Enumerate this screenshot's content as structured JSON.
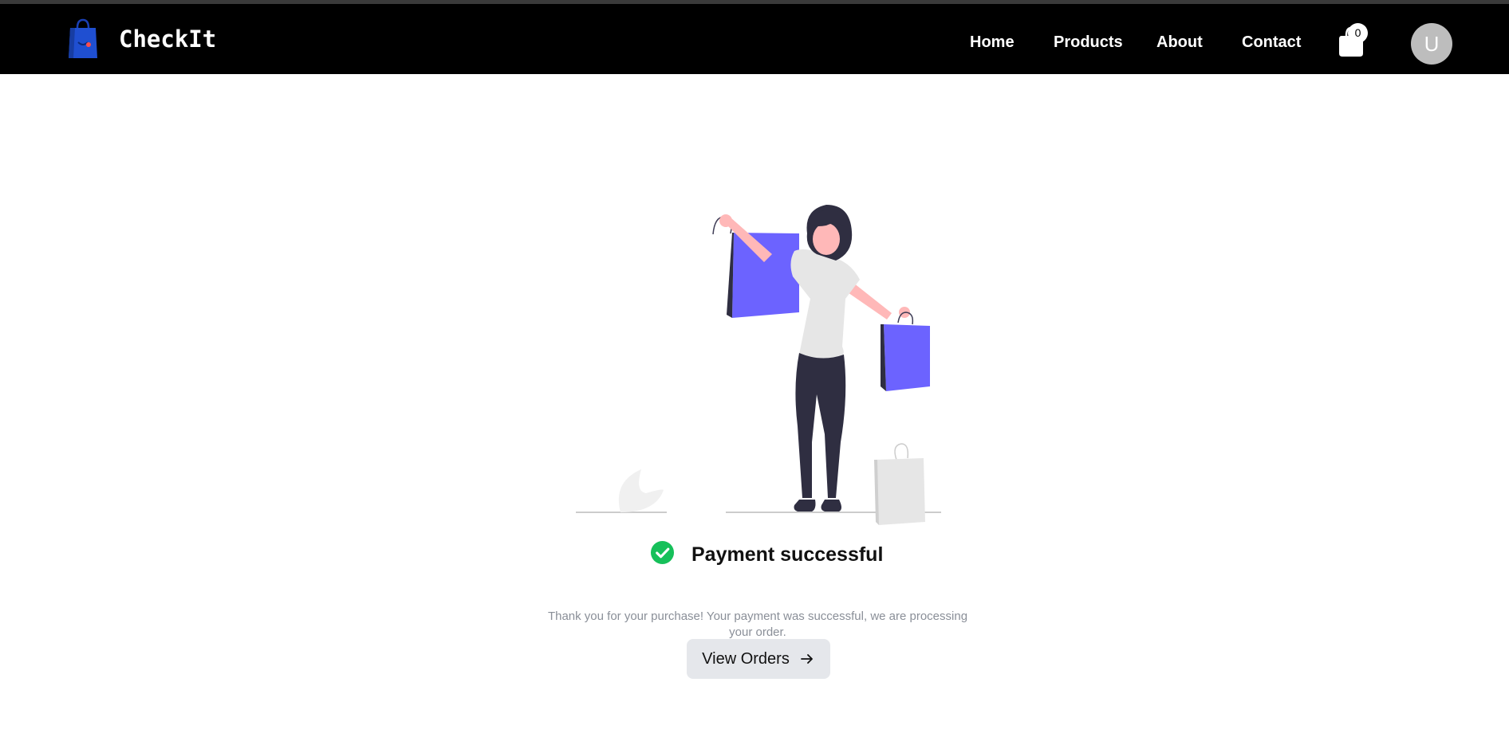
{
  "header": {
    "brand": "CheckIt",
    "logo_icon": "shopping-bag-logo-icon",
    "nav": [
      {
        "label": "Home"
      },
      {
        "label": "Products"
      },
      {
        "label": "About"
      },
      {
        "label": "Contact"
      }
    ],
    "cart": {
      "icon": "shopping-bag-icon",
      "count": "0"
    },
    "avatar": {
      "initial": "U"
    }
  },
  "main": {
    "illustration": "woman-with-shopping-bags-illustration",
    "status_icon": "check-circle-icon",
    "status_title": "Payment successful",
    "message": "Thank you for your purchase! Your payment was successful, we are processing your order.",
    "button": {
      "label": "View Orders",
      "icon": "arrow-right-icon"
    }
  },
  "colors": {
    "navbar": "#000000",
    "success": "#16c05a",
    "accent_bag": "#6c63ff",
    "button_bg": "#e5e7eb",
    "muted_text": "#8a8f98"
  }
}
